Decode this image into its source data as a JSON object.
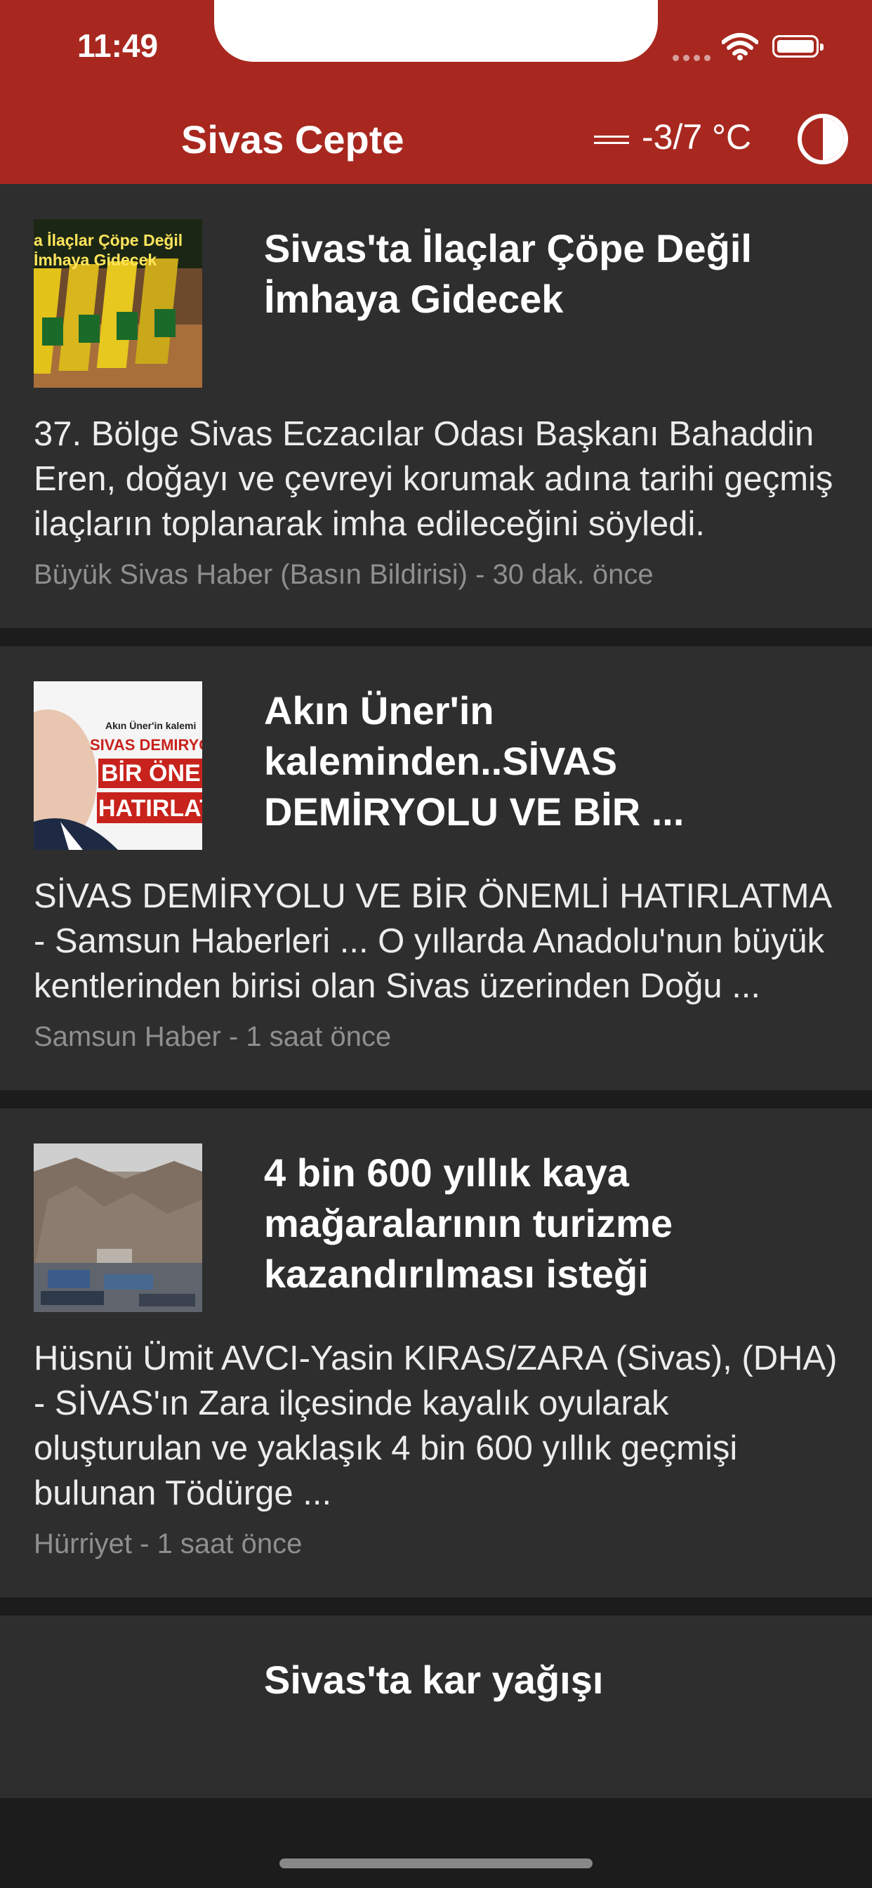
{
  "status_bar": {
    "time": "11:49"
  },
  "header": {
    "title": "Sivas Cepte",
    "weather": "-3/7 °C",
    "weather_icon": "fog-icon",
    "theme_icon": "contrast-icon",
    "bg_color": "#a8281f"
  },
  "articles": [
    {
      "title": "Sivas'ta İlaçlar Çöpe Değil İmhaya Gidecek",
      "summary": "37. Bölge Sivas Eczacılar Odası Başkanı Bahaddin Eren, doğayı ve çevreyi korumak adına tarihi geçmiş ilaçların toplanarak imha edileceğini söyledi.",
      "meta": "Büyük Sivas Haber (Basın Bildirisi) - 30 dak. önce",
      "thumb_lines": [
        "a İlaçlar Çöpe Değil",
        "İmhaya Gidecek"
      ]
    },
    {
      "title": "Akın Üner'in kaleminden..SİVAS DEMİRYOLU VE BİR ...",
      "summary": "SİVAS DEMİRYOLU VE BİR ÖNEMLİ HATIRLATMA - Samsun Haberleri ... O yıllarda Anadolu'nun büyük kentlerinden birisi olan Sivas üzerinden Doğu ...",
      "meta": "Samsun Haber - 1 saat önce",
      "thumb_lines": [
        "Akın Üner'in kalemi",
        "SIVAS DEMIRYO",
        "BİR ÖNE",
        "HATIRLAT"
      ]
    },
    {
      "title": "4 bin 600 yıllık kaya mağaralarının turizme kazandırılması isteği",
      "summary": "Hüsnü Ümit AVCI-Yasin KIRAS/ZARA (Sivas), (DHA) - SİVAS'ın Zara ilçesinde kayalık oyularak oluşturulan ve yaklaşık 4 bin 600 yıllık geçmişi bulunan Tödürge ...",
      "meta": "Hürriyet - 1 saat önce"
    },
    {
      "title": "Sivas'ta kar yağışı"
    }
  ]
}
